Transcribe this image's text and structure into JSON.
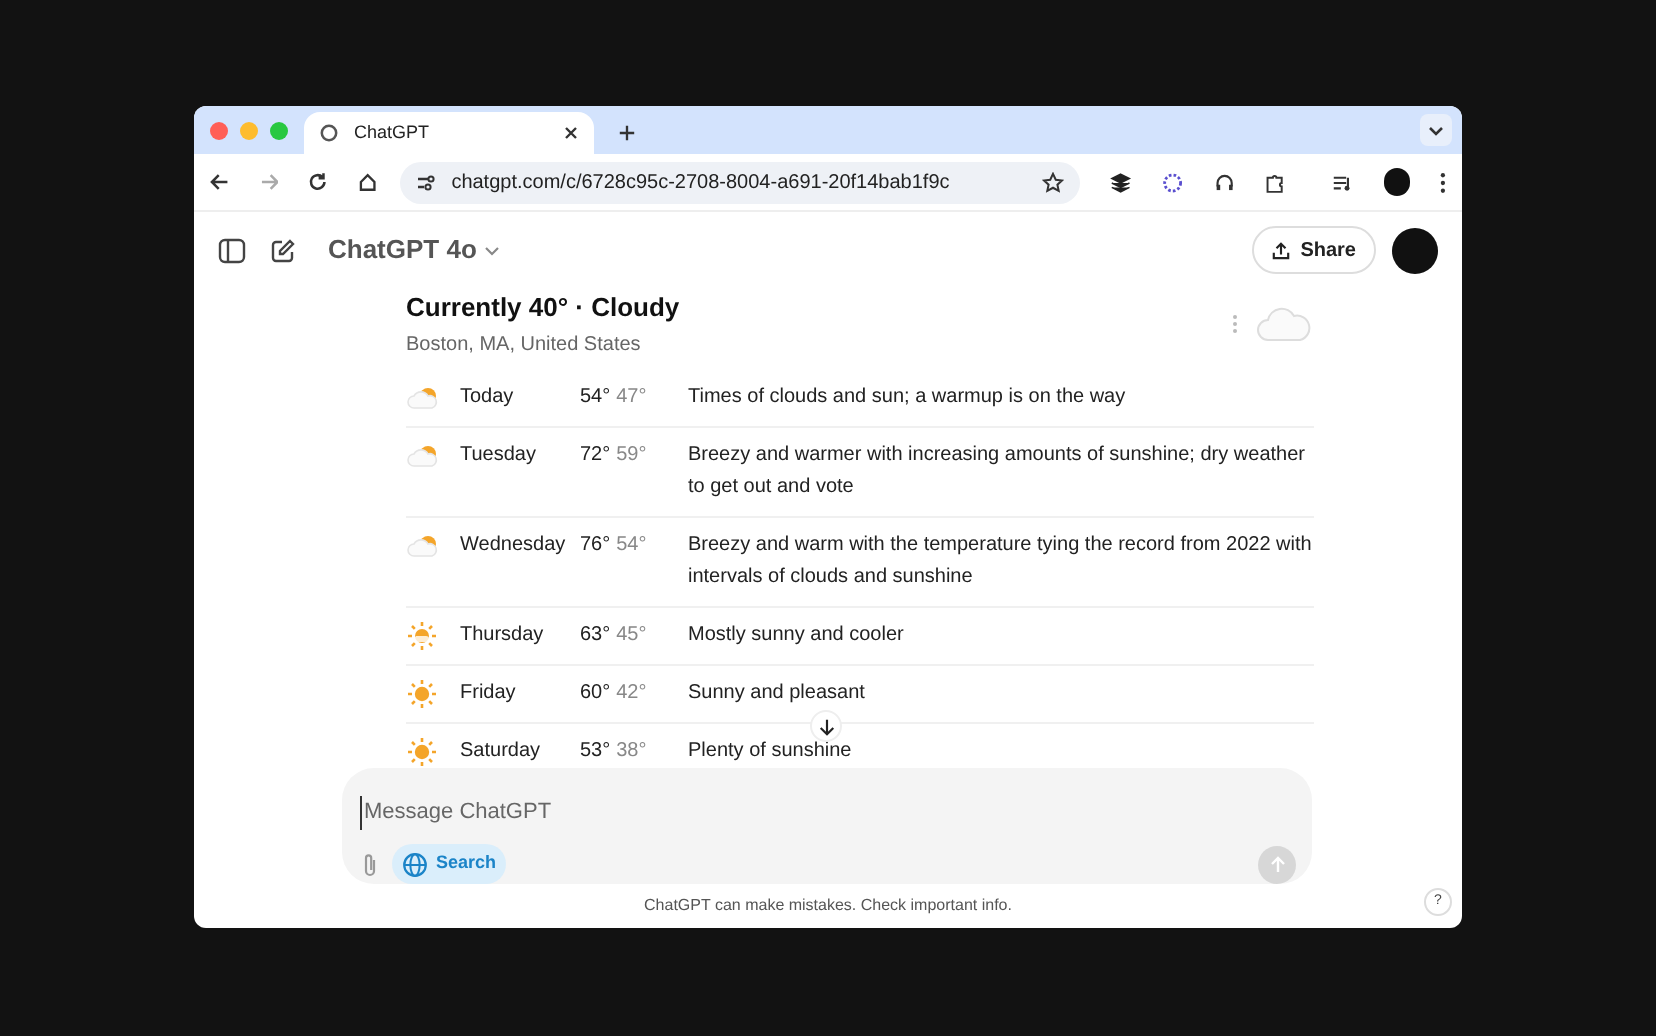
{
  "browser": {
    "tab": {
      "title": "ChatGPT"
    },
    "url": "chatgpt.com/c/6728c95c-2708-8004-a691-20f14bab1f9c"
  },
  "header": {
    "model": "ChatGPT 4o",
    "share": "Share"
  },
  "weather": {
    "title": "Currently 40° · Cloudy",
    "location": "Boston, MA, United States",
    "days": [
      {
        "day": "Today",
        "high": "54°",
        "low": "47°",
        "summary": "Times of clouds and sun; a warmup is on the way",
        "kind": "partly_cloudy"
      },
      {
        "day": "Tuesday",
        "high": "72°",
        "low": "59°",
        "summary": "Breezy and warmer with increasing amounts of sunshine; dry weather to get out and vote",
        "kind": "partly_cloudy"
      },
      {
        "day": "Wednesday",
        "high": "76°",
        "low": "54°",
        "summary": "Breezy and warm with the temperature tying the record from 2022 with intervals of clouds and sunshine",
        "kind": "partly_cloudy"
      },
      {
        "day": "Thursday",
        "high": "63°",
        "low": "45°",
        "summary": "Mostly sunny and cooler",
        "kind": "mostly_sunny"
      },
      {
        "day": "Friday",
        "high": "60°",
        "low": "42°",
        "summary": "Sunny and pleasant",
        "kind": "sunny"
      },
      {
        "day": "Saturday",
        "high": "53°",
        "low": "38°",
        "summary": "Plenty of sunshine",
        "kind": "sunny"
      }
    ]
  },
  "composer": {
    "placeholder": "Message ChatGPT",
    "search": {
      "label": "Search",
      "selected": true
    }
  },
  "footer": {
    "disclaimer": "ChatGPT can make mistakes. Check important info.",
    "help": "?"
  }
}
